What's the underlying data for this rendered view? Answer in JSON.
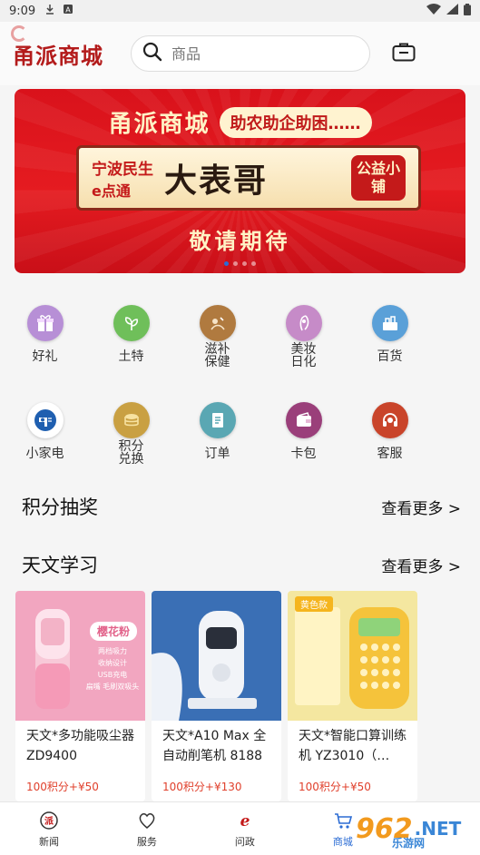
{
  "status_bar": {
    "time": "9:09"
  },
  "header": {
    "logo_text": "甬派商城",
    "search_placeholder": "商品"
  },
  "banner": {
    "title": "甬派商城",
    "slogan": "助农助企助困……",
    "brand_line1": "宁波民生",
    "brand_line2": "e点通",
    "main_text": "大表哥",
    "badge_text": "公益小铺",
    "subtitle": "敬请期待",
    "pages": 4,
    "active_page": 1
  },
  "categories_row1": [
    {
      "label": "好礼",
      "icon": "gift-icon",
      "color": "#b78fd6"
    },
    {
      "label": "土特",
      "icon": "leaf-icon",
      "color": "#6fbf5a"
    },
    {
      "label": "滋补\n保健",
      "icon": "herbal-icon",
      "color": "#b07a3f"
    },
    {
      "label": "美妆\n日化",
      "icon": "beauty-icon",
      "color": "#c68bc8"
    },
    {
      "label": "百货",
      "icon": "basket-icon",
      "color": "#5aa0d8"
    }
  ],
  "categories_row2": [
    {
      "label": "小家电",
      "icon": "hairdryer-icon",
      "color": "#1f5fb0"
    },
    {
      "label": "积分\n兑换",
      "icon": "coins-icon",
      "color": "#c9a042"
    },
    {
      "label": "订单",
      "icon": "document-icon",
      "color": "#5aa7b3"
    },
    {
      "label": "卡包",
      "icon": "wallet-icon",
      "color": "#9a3f7a"
    },
    {
      "label": "客服",
      "icon": "headset-icon",
      "color": "#c9442a"
    }
  ],
  "sections": {
    "points_lottery": {
      "title": "积分抽奖",
      "more": "查看更多 >"
    },
    "astronomy": {
      "title": "天文学习",
      "more": "查看更多 >"
    }
  },
  "products": [
    {
      "name": "天文*多功能吸尘器ZD9400",
      "price": "100积分+¥50",
      "image_tag": "樱花粉",
      "image_lines": [
        "两档吸力",
        "收纳设计",
        "USB充电",
        "扁嘴 毛刷双吸头"
      ],
      "bg": "#f2a6c0"
    },
    {
      "name": "天文*A10 Max 全自动削笔机 8188",
      "price": "100积分+¥130",
      "bg": "#3a6fb5"
    },
    {
      "name": "天文*智能口算训练机 YZ3010（…",
      "price": "100积分+¥50",
      "image_tag": "黄色款",
      "bg": "#f4e7a0"
    }
  ],
  "tabbar": [
    {
      "label": "新闻",
      "icon": "news-icon",
      "active": false
    },
    {
      "label": "服务",
      "icon": "service-icon",
      "active": false
    },
    {
      "label": "问政",
      "icon": "inquiry-icon",
      "active": false
    },
    {
      "label": "商城",
      "icon": "cart-icon",
      "active": true
    }
  ],
  "watermark": {
    "logo": "962",
    "text": ".NET",
    "sub": "乐游网"
  },
  "colors": {
    "accent": "#2b6cd4",
    "price": "#e0402c",
    "logo_red": "#b31b1b"
  }
}
